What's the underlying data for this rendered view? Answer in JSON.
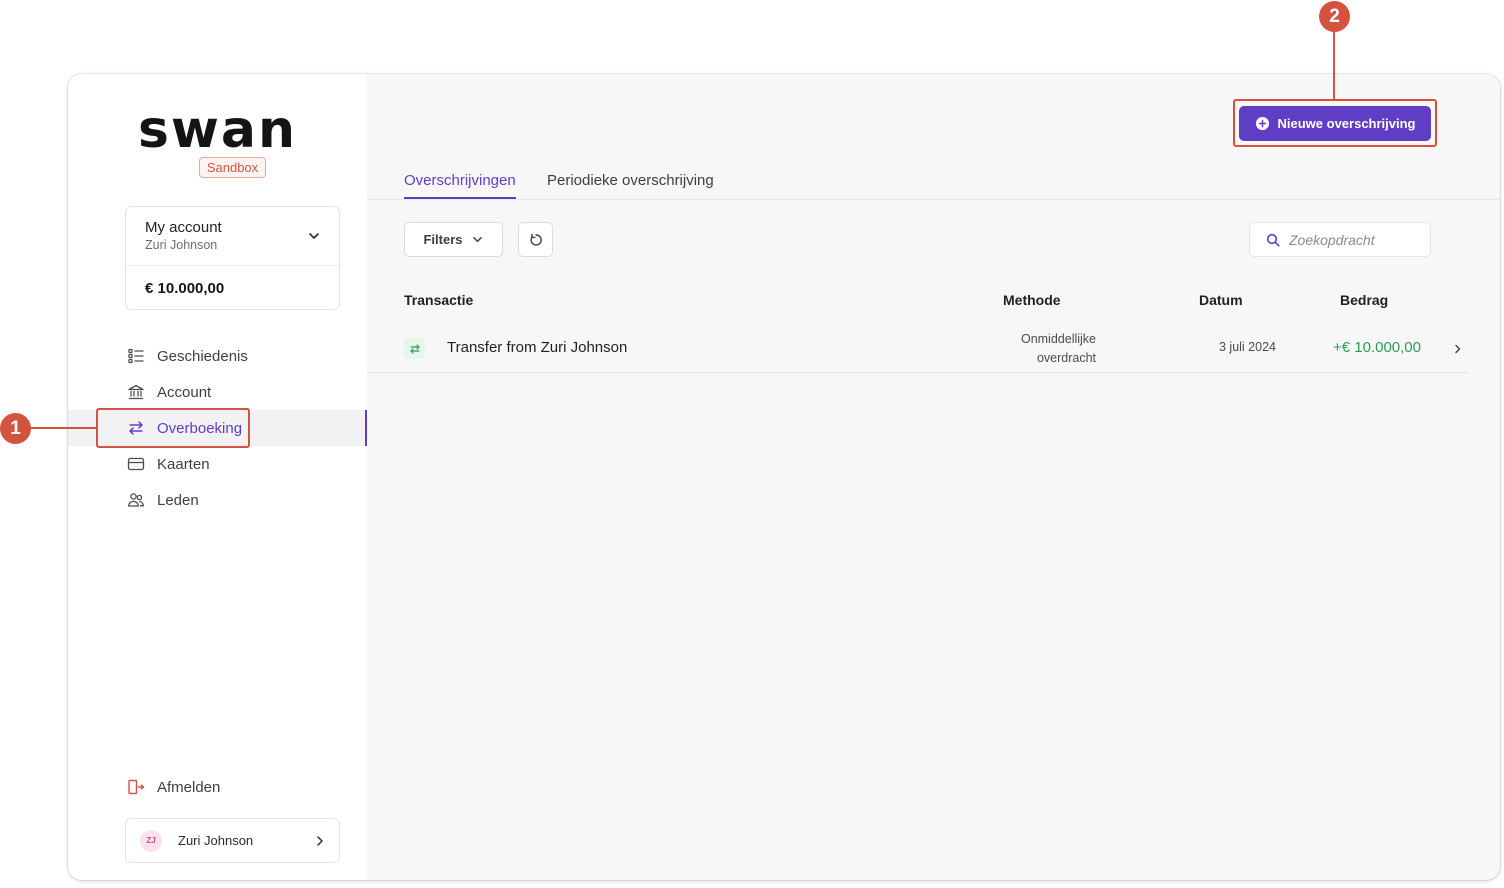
{
  "brand": {
    "logo_text": "swan",
    "env_badge": "Sandbox"
  },
  "account": {
    "name": "My account",
    "holder": "Zuri Johnson",
    "balance": "€ 10.000,00"
  },
  "sidebar": {
    "items": [
      {
        "label": "Geschiedenis",
        "icon": "list-icon"
      },
      {
        "label": "Account",
        "icon": "bank-icon"
      },
      {
        "label": "Overboeking",
        "icon": "transfer-icon",
        "active": true
      },
      {
        "label": "Kaarten",
        "icon": "card-icon"
      },
      {
        "label": "Leden",
        "icon": "members-icon"
      }
    ],
    "logout_label": "Afmelden"
  },
  "user": {
    "initials": "ZJ",
    "name": "Zuri Johnson"
  },
  "header": {
    "new_transfer_label": "Nieuwe overschrijving"
  },
  "tabs": [
    {
      "label": "Overschrijvingen",
      "active": true
    },
    {
      "label": "Periodieke overschrijving",
      "active": false
    }
  ],
  "toolbar": {
    "filters_label": "Filters",
    "search_placeholder": "Zoekopdracht"
  },
  "table": {
    "headers": {
      "transaction": "Transactie",
      "method": "Methode",
      "date": "Datum",
      "amount": "Bedrag"
    },
    "rows": [
      {
        "name": "Transfer from Zuri Johnson",
        "method_line1": "Onmiddellijke",
        "method_line2": "overdracht",
        "date": "3 juli 2024",
        "amount": "+€ 10.000,00"
      }
    ]
  },
  "annotations": {
    "marker1": "1",
    "marker2": "2"
  },
  "colors": {
    "accent": "#5f3dc4",
    "annotation": "#d4533f",
    "positive": "#2a9d55"
  }
}
